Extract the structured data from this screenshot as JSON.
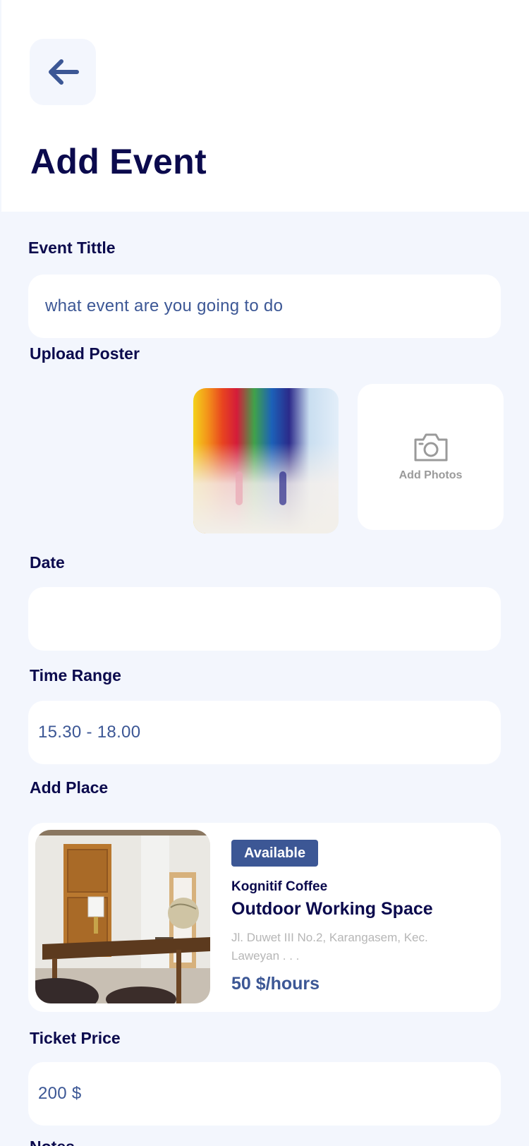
{
  "header": {
    "back_icon": "arrow-left-icon",
    "title": "Add Event"
  },
  "form": {
    "event_title": {
      "label": "Event Tittle",
      "placeholder": "what event are you going to do"
    },
    "upload_poster": {
      "label": "Upload Poster",
      "add_photos_label": "Add Photos",
      "add_photos_icon": "camera-icon"
    },
    "date": {
      "label": "Date",
      "value": ""
    },
    "time_range": {
      "label": "Time Range",
      "value": "15.30 - 18.00"
    },
    "add_place": {
      "label": "Add Place",
      "card": {
        "badge": "Available",
        "venue": "Kognitif Coffee",
        "title": "Outdoor Working Space",
        "address": "Jl. Duwet III No.2, Karangasem, Kec. Laweyan . . .",
        "price": "50 $/hours"
      }
    },
    "ticket_price": {
      "label": "Ticket Price",
      "value": "200 $"
    },
    "notes": {
      "label": "Notes"
    }
  },
  "colors": {
    "background": "#f3f6fd",
    "surface": "#ffffff",
    "heading": "#0b0a4d",
    "accent": "#3c5795",
    "muted": "#b6b6b6"
  }
}
